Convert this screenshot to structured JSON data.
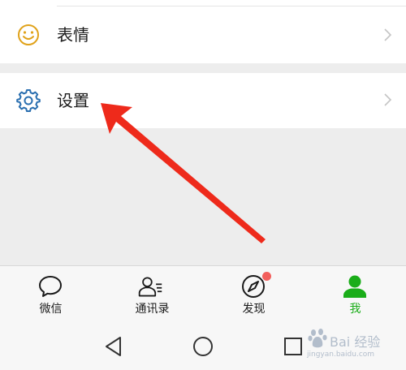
{
  "menu": {
    "emoji_label": "表情",
    "settings_label": "设置"
  },
  "tabs": [
    {
      "label": "微信",
      "icon": "chat-bubble-icon"
    },
    {
      "label": "通讯录",
      "icon": "contacts-icon"
    },
    {
      "label": "发现",
      "icon": "compass-icon"
    },
    {
      "label": "我",
      "icon": "person-icon"
    }
  ],
  "active_tab": "我",
  "colors": {
    "accent_green": "#1aad19",
    "icon_blue": "#2a6fb0",
    "emoji_orange": "#e0a21a",
    "badge_red": "#f25f5c",
    "annotation_red": "#ee2a1b"
  },
  "nav": {
    "back": "back-triangle-icon",
    "home": "home-circle-icon",
    "recent": "recent-square-icon"
  },
  "watermark": {
    "text": "Bai 经验",
    "sub": "jingyan.baidu.com"
  }
}
